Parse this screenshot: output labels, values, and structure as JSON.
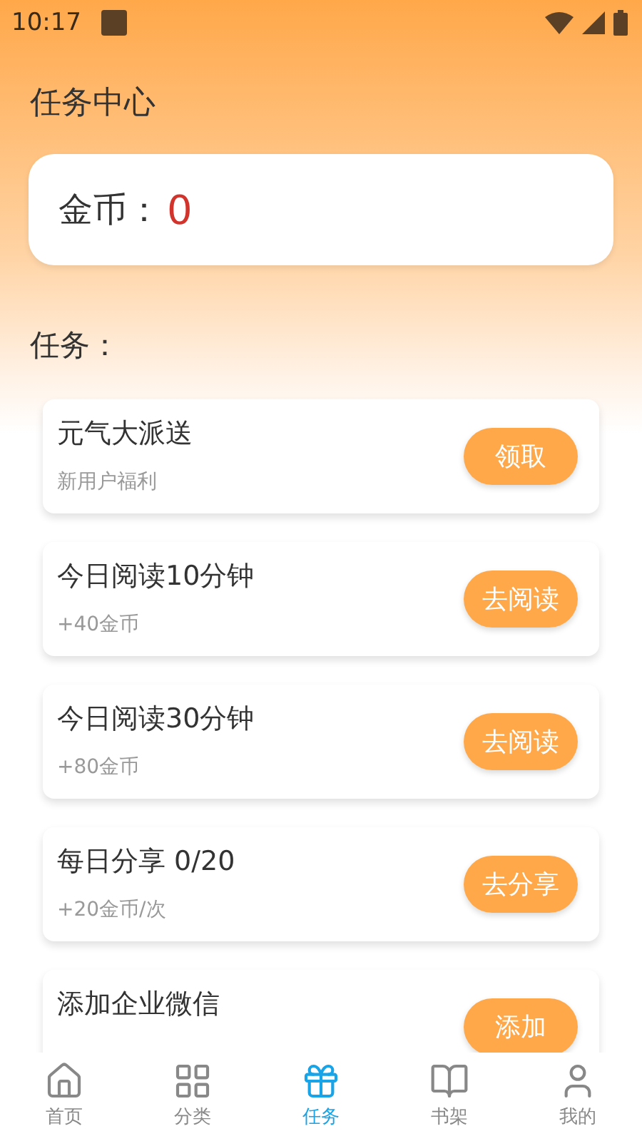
{
  "status_bar": {
    "time": "10:17"
  },
  "title": "任务中心",
  "coins": {
    "label": "金币：",
    "value": "0"
  },
  "tasks_heading": "任务：",
  "tasks": [
    {
      "title": "元气大派送",
      "subtitle": "新用户福利",
      "action": "领取"
    },
    {
      "title": "今日阅读10分钟",
      "subtitle": "+40金币",
      "action": "去阅读"
    },
    {
      "title": "今日阅读30分钟",
      "subtitle": "+80金币",
      "action": "去阅读"
    },
    {
      "title": "每日分享 0/20",
      "subtitle": "+20金币/次",
      "action": "去分享"
    },
    {
      "title": "添加企业微信",
      "action": "添加"
    }
  ],
  "nav": [
    {
      "label": "首页",
      "selected": false
    },
    {
      "label": "分类",
      "selected": false
    },
    {
      "label": "任务",
      "selected": true
    },
    {
      "label": "书架",
      "selected": false
    },
    {
      "label": "我的",
      "selected": false
    }
  ]
}
